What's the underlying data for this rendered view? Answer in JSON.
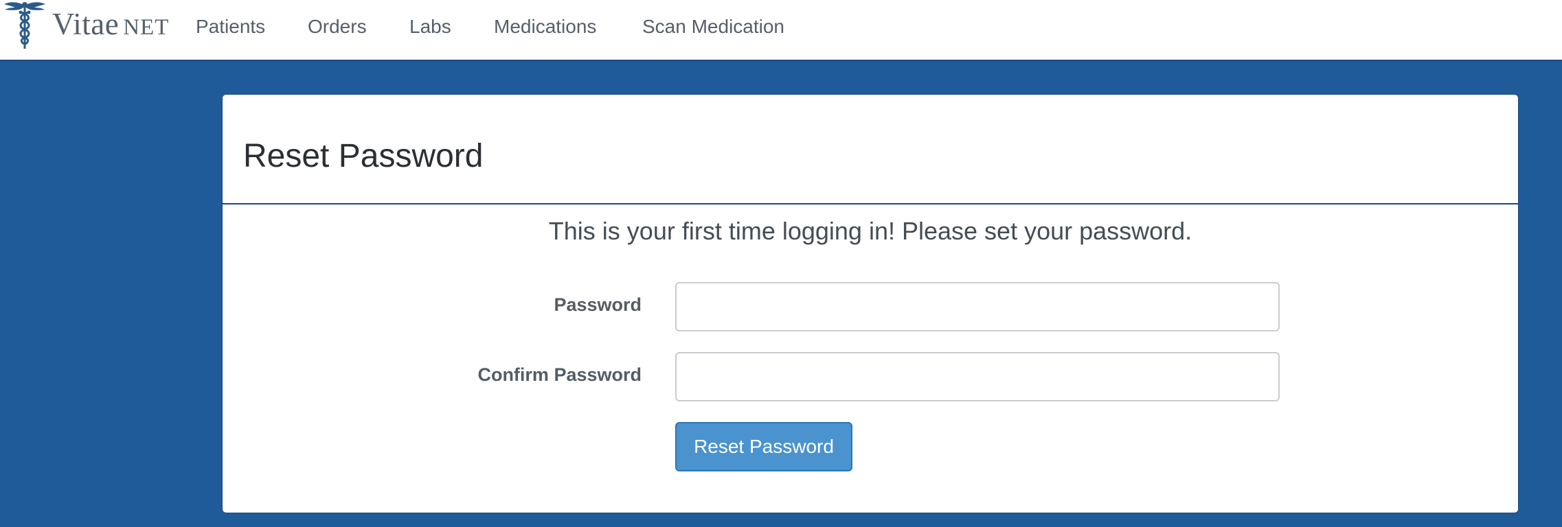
{
  "navbar": {
    "brand": {
      "name": "Vitae",
      "suffix": "NET",
      "logo_icon": "caduceus-icon",
      "color": "#2a5a8a"
    },
    "items": [
      {
        "label": "Patients"
      },
      {
        "label": "Orders"
      },
      {
        "label": "Labs"
      },
      {
        "label": "Medications"
      },
      {
        "label": "Scan Medication"
      }
    ]
  },
  "panel": {
    "title": "Reset Password",
    "intro": "This is your first time logging in! Please set your password."
  },
  "form": {
    "password": {
      "label": "Password",
      "value": "",
      "placeholder": ""
    },
    "confirm_password": {
      "label": "Confirm Password",
      "value": "",
      "placeholder": ""
    },
    "submit_label": "Reset Password"
  },
  "colors": {
    "background": "#1f5a99",
    "panel_border": "#174a80",
    "button": "#4a93cf"
  }
}
